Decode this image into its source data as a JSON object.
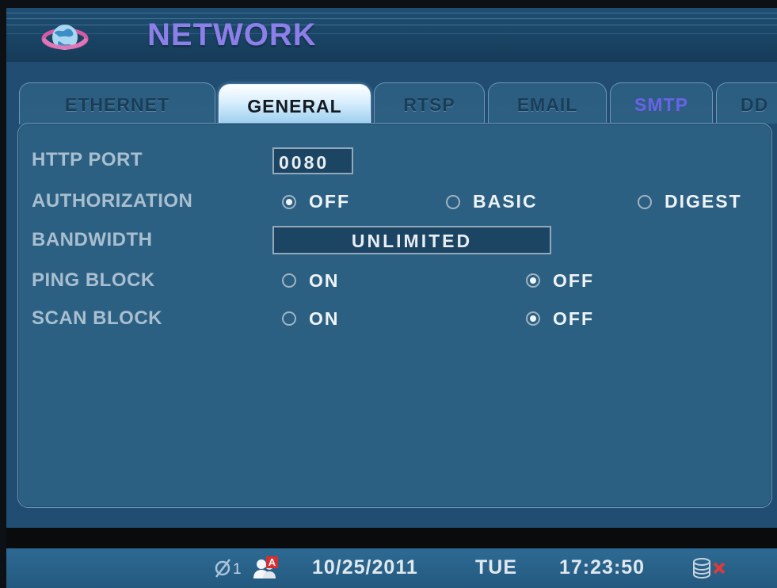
{
  "header": {
    "title": "NETWORK",
    "logo_icon": "globe-icon"
  },
  "tabs": [
    {
      "label": "ETHERNET",
      "active": false
    },
    {
      "label": "GENERAL",
      "active": true
    },
    {
      "label": "RTSP",
      "active": false
    },
    {
      "label": "EMAIL",
      "active": false
    },
    {
      "label": "SMTP",
      "active": false
    },
    {
      "label": "DD",
      "active": false
    }
  ],
  "settings": {
    "http_port": {
      "label": "HTTP PORT",
      "value": "0080"
    },
    "authorization": {
      "label": "AUTHORIZATION",
      "options": [
        "OFF",
        "BASIC",
        "DIGEST"
      ],
      "selected": "OFF"
    },
    "bandwidth": {
      "label": "BANDWIDTH",
      "value": "UNLIMITED"
    },
    "ping_block": {
      "label": "PING BLOCK",
      "options": [
        "ON",
        "OFF"
      ],
      "selected": "OFF"
    },
    "scan_block": {
      "label": "SCAN BLOCK",
      "options": [
        "ON",
        "OFF"
      ],
      "selected": "OFF"
    }
  },
  "status_bar": {
    "channel_count": "1",
    "user_badge": "A",
    "date": "10/25/2011",
    "day": "TUE",
    "time": "17:23:50",
    "icons": [
      "no-signal-icon",
      "user-icon",
      "disk-icon",
      "error-x-icon"
    ]
  },
  "colors": {
    "title": "#8d7fe9",
    "panel": "#2c6083",
    "active_tab": "#d7eefc",
    "smtp_tab": "#6a63e6"
  }
}
